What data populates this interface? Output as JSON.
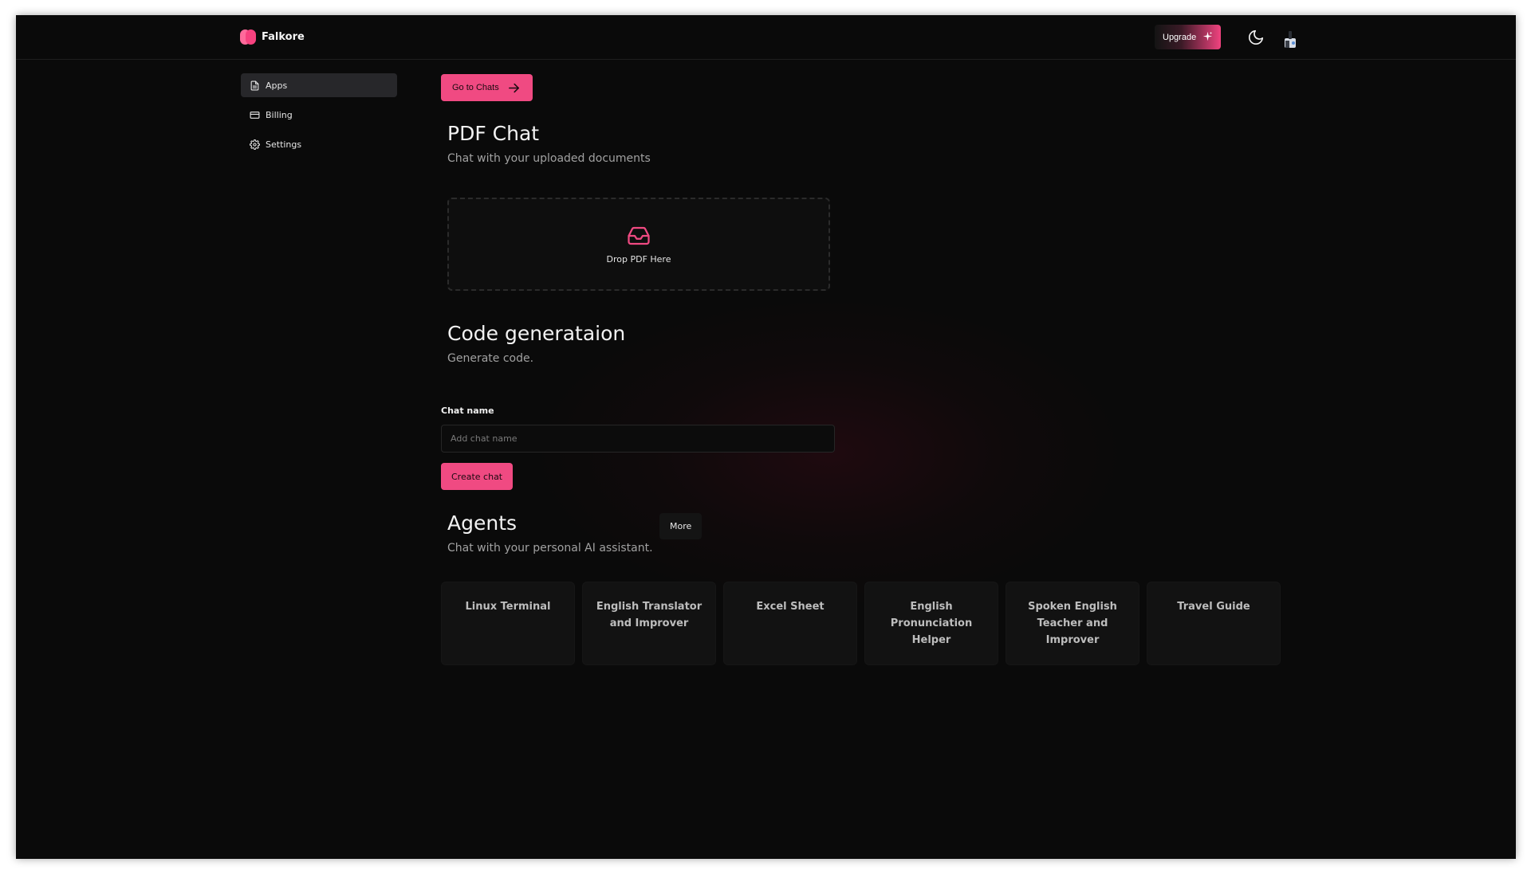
{
  "app": {
    "name": "Falkore"
  },
  "header": {
    "upgrade_label": "Upgrade",
    "accent": "#f04a82"
  },
  "sidebar": {
    "items": [
      {
        "label": "Apps",
        "icon": "file-icon",
        "active": true
      },
      {
        "label": "Billing",
        "icon": "credit-card-icon",
        "active": false
      },
      {
        "label": "Settings",
        "icon": "gear-icon",
        "active": false
      }
    ]
  },
  "main": {
    "go_to_chats_label": "Go to Chats",
    "pdf_chat": {
      "title": "PDF Chat",
      "subtitle": "Chat with your uploaded documents",
      "dropzone_label": "Drop PDF Here"
    },
    "code_generation": {
      "title": "Code generataion",
      "subtitle": "Generate code.",
      "chat_name_label": "Chat name",
      "chat_name_placeholder": "Add chat name",
      "chat_name_value": "",
      "create_chat_label": "Create chat"
    },
    "agents": {
      "title": "Agents",
      "subtitle": "Chat with your personal AI assistant.",
      "more_label": "More",
      "cards": [
        {
          "label": "Linux Terminal"
        },
        {
          "label": "English Translator and Improver"
        },
        {
          "label": "Excel Sheet"
        },
        {
          "label": "English Pronunciation Helper"
        },
        {
          "label": "Spoken English Teacher and Improver"
        },
        {
          "label": "Travel Guide"
        }
      ]
    }
  }
}
